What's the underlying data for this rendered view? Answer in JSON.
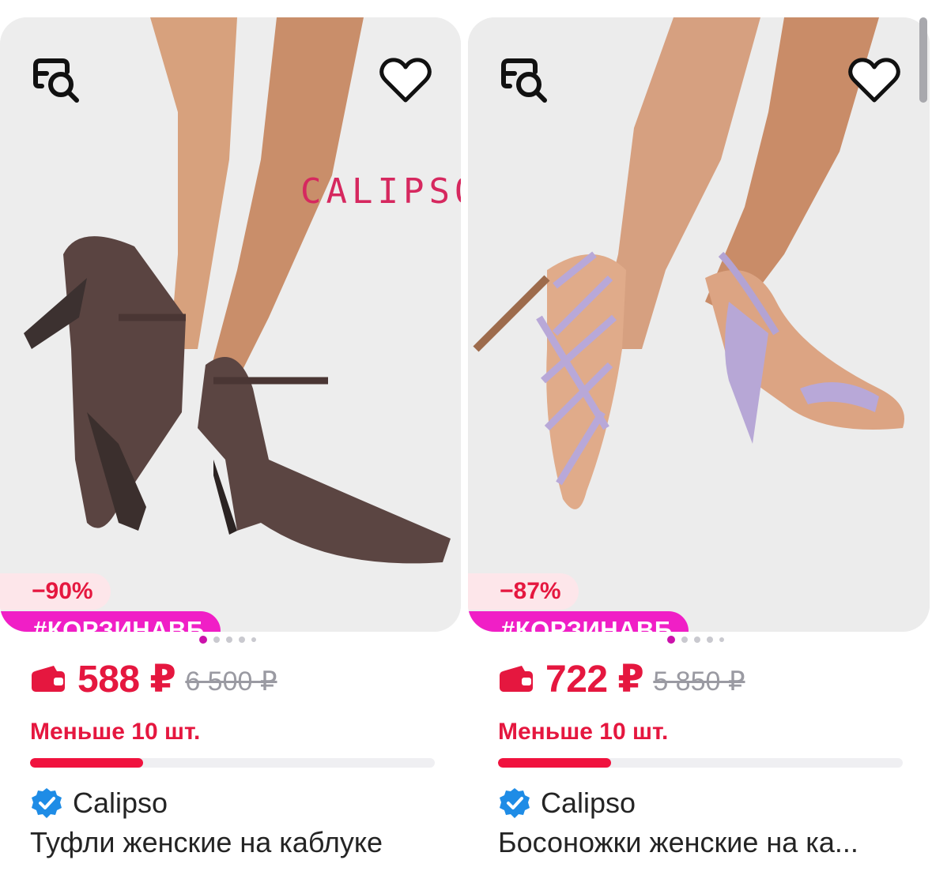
{
  "products": [
    {
      "watermark": "CALIPSO",
      "discount": "−90%",
      "promo": "#КОРЗИНАВБ",
      "price": "588 ₽",
      "old_price": "6 500 ₽",
      "stock": "Меньше 10 шт.",
      "stock_level": 0.28,
      "seller": "Calipso",
      "title": "Туфли женские на каблуке"
    },
    {
      "discount": "−87%",
      "promo": "#КОРЗИНАВБ",
      "price": "722 ₽",
      "old_price": "5 850 ₽",
      "stock": "Меньше 10 шт.",
      "stock_level": 0.28,
      "seller": "Calipso",
      "title": "Босоножки женские на ка..."
    }
  ],
  "colors": {
    "accent_red": "#e5173f",
    "promo_pink": "#f01fc6",
    "dot_active": "#cb11ab",
    "verified_blue": "#1e8ce6"
  },
  "icons": [
    "find-similar-icon",
    "heart-icon",
    "wallet-icon",
    "verified-icon"
  ]
}
